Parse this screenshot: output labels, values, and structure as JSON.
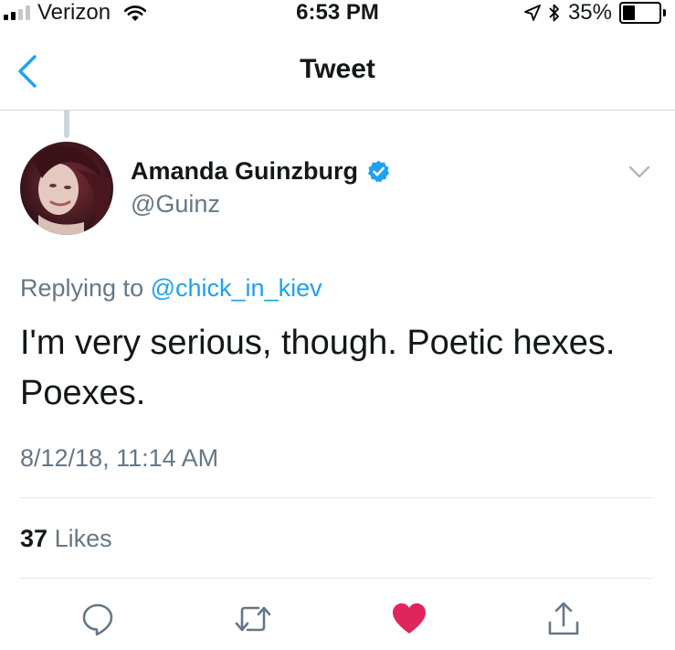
{
  "status_bar": {
    "carrier": "Verizon",
    "time": "6:53 PM",
    "battery_percent": "35%",
    "battery_level": 0.35,
    "signal_bars_active": 2,
    "signal_bars_total": 4
  },
  "nav": {
    "title": "Tweet",
    "back_icon": "chevron-left-icon"
  },
  "tweet": {
    "author_name": "Amanda Guinzburg",
    "author_handle": "@Guinz",
    "verified": true,
    "reply_prefix": "Replying to",
    "reply_handle": "@chick_in_kiev",
    "text": "I'm very serious, though. Poetic hexes. Poexes.",
    "timestamp": "8/12/18, 11:14 AM",
    "likes_count": "37",
    "likes_label": "Likes"
  },
  "actions": [
    {
      "name": "reply",
      "icon": "reply-bubble-icon"
    },
    {
      "name": "retweet",
      "icon": "retweet-icon"
    },
    {
      "name": "like",
      "icon": "heart-icon",
      "active": true
    },
    {
      "name": "share",
      "icon": "share-icon"
    }
  ],
  "colors": {
    "accent": "#1da1f2",
    "secondary_text": "#657786",
    "like_active": "#e0245e",
    "divider": "#e1e8ed"
  }
}
